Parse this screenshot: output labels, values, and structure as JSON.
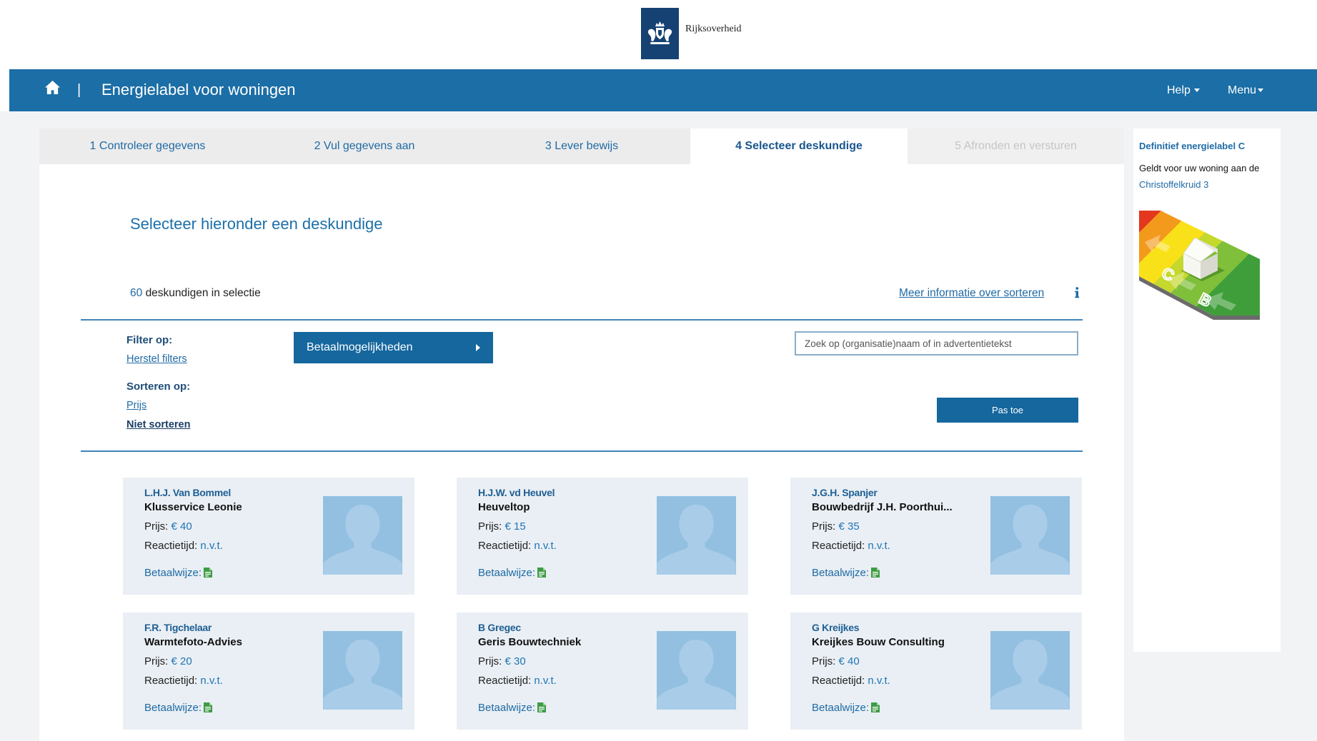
{
  "brand": {
    "name": "Rijksoverheid"
  },
  "nav": {
    "separator": "|",
    "title": "Energielabel voor woningen",
    "help": "Help",
    "menu": "Menu"
  },
  "steps": [
    "1 Controleer gegevens",
    "2 Vul gegevens aan",
    "3 Lever bewijs",
    "4 Selecteer deskundige",
    "5 Afronden en versturen"
  ],
  "main": {
    "heading": "Selecteer hieronder een deskundige",
    "count": "60",
    "count_suffix": "deskundigen in selectie",
    "sort_info_link": "Meer informatie over sorteren",
    "filter_label": "Filter op:",
    "reset_filters": "Herstel filters",
    "sort_label": "Sorteren op:",
    "sort_options": [
      "Prijs",
      "Niet sorteren"
    ],
    "payment_button": "Betaalmogelijkheden",
    "search_placeholder": "Zoek op (organisatie)naam of in advertentietekst",
    "apply_button": "Pas toe"
  },
  "card_labels": {
    "price": "Prijs:",
    "response": "Reactietijd:",
    "payment": "Betaalwijze:"
  },
  "experts": [
    {
      "name": "L.H.J. Van Bommel",
      "company": "Klusservice Leonie",
      "price": "€ 40",
      "response": "n.v.t."
    },
    {
      "name": "H.J.W. vd Heuvel",
      "company": "Heuveltop",
      "price": "€ 15",
      "response": "n.v.t."
    },
    {
      "name": "J.G.H. Spanjer",
      "company": "Bouwbedrijf J.H. Poorthui...",
      "price": "€ 35",
      "response": "n.v.t."
    },
    {
      "name": "F.R. Tigchelaar",
      "company": "Warmtefoto-Advies",
      "price": "€ 20",
      "response": "n.v.t."
    },
    {
      "name": "B Gregec",
      "company": "Geris Bouwtechniek",
      "price": "€ 30",
      "response": "n.v.t."
    },
    {
      "name": "G Kreijkes",
      "company": "Kreijkes Bouw Consulting",
      "price": "€ 40",
      "response": "n.v.t."
    }
  ],
  "sidebar": {
    "title": "Definitief energielabel C",
    "subtitle": "Geldt voor uw woning aan de",
    "address": "Christoffelkruid 3",
    "illustration_letters": [
      "C",
      "B"
    ]
  },
  "icons": {
    "home": "home-icon",
    "info": "info-icon",
    "payment": "document-icon",
    "avatar": "user-placeholder-icon"
  },
  "colors": {
    "nav_bg": "#1b6ea6",
    "accent": "#15679e",
    "link": "#1f6aa5",
    "card_bg": "#e9eff4",
    "avatar_bg": "#93c0e1",
    "page_bg": "#f2f3f5",
    "logo_bg": "#154273",
    "payment_green": "#3f9b45"
  }
}
